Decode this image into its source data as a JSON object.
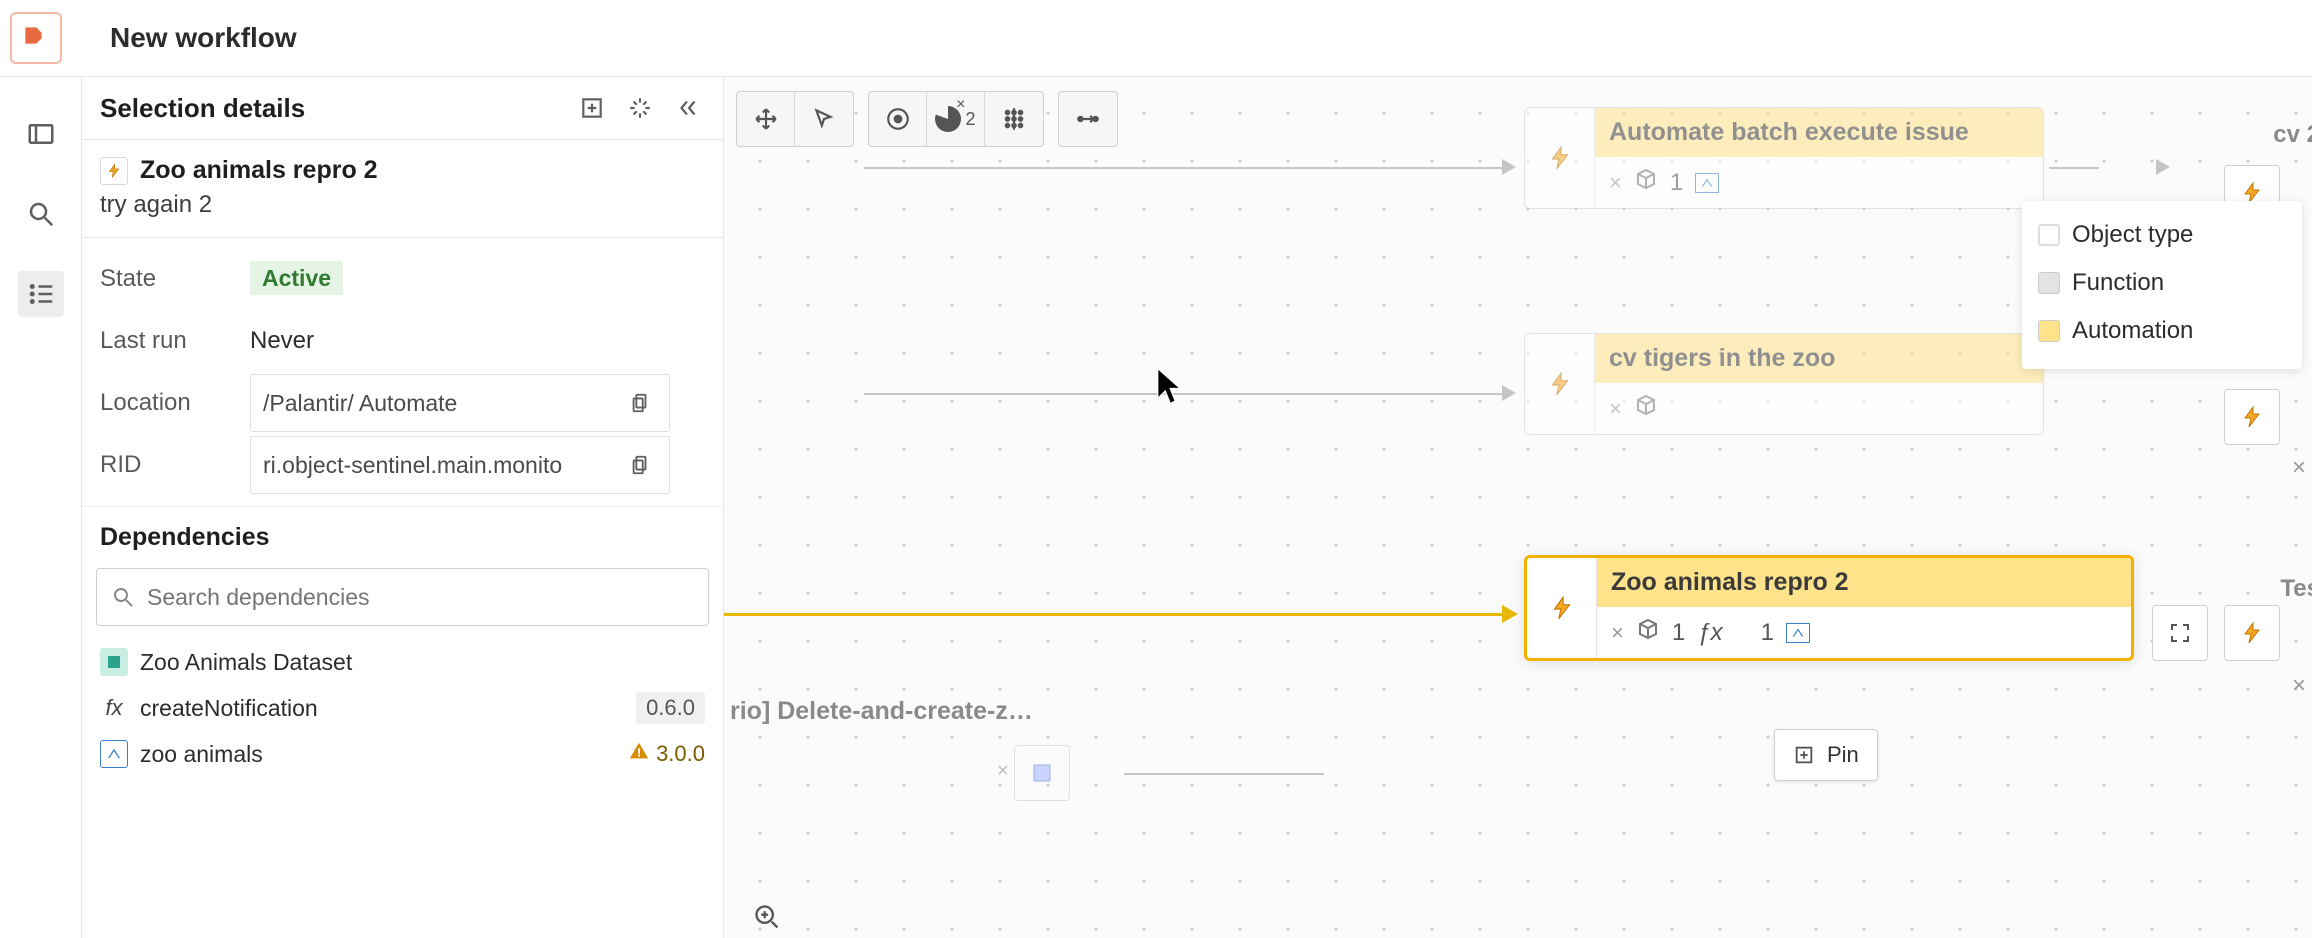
{
  "app": {
    "title": "New workflow"
  },
  "sidebar": {
    "section_title": "Selection details",
    "selection": {
      "title": "Zoo animals repro 2",
      "subtitle": "try again 2"
    },
    "kv": {
      "state_key": "State",
      "state_value": "Active",
      "lastrun_key": "Last run",
      "lastrun_value": "Never",
      "location_key": "Location",
      "location_value": "/Palantir/           Automate",
      "rid_key": "RID",
      "rid_value": "ri.object-sentinel.main.monito"
    },
    "deps": {
      "title": "Dependencies",
      "search_placeholder": "Search dependencies",
      "items": [
        {
          "label": "Zoo Animals Dataset",
          "version": "",
          "type": "dataset"
        },
        {
          "label": "createNotification",
          "version": "0.6.0",
          "type": "function"
        },
        {
          "label": "zoo animals",
          "version": "3.0.0",
          "type": "objecttype",
          "warn": true
        }
      ]
    }
  },
  "legend": {
    "items": [
      {
        "label": "Object type",
        "kind": "obj"
      },
      {
        "label": "Function",
        "kind": "fn"
      },
      {
        "label": "Automation",
        "kind": "au"
      }
    ]
  },
  "canvas": {
    "nodes": {
      "n1": {
        "title": "Automate batch execute issue",
        "count1": "1"
      },
      "n2": {
        "title": "cv tigers in the zoo"
      },
      "n3": {
        "title": "Zoo animals repro 2",
        "count_fx": "1",
        "count_ot": "1"
      },
      "ghost1": "rio] Delete-and-create-z…",
      "right1": "cv 2",
      "right2": "Tes"
    },
    "pin_label": "Pin",
    "toolbar_count": "2"
  }
}
